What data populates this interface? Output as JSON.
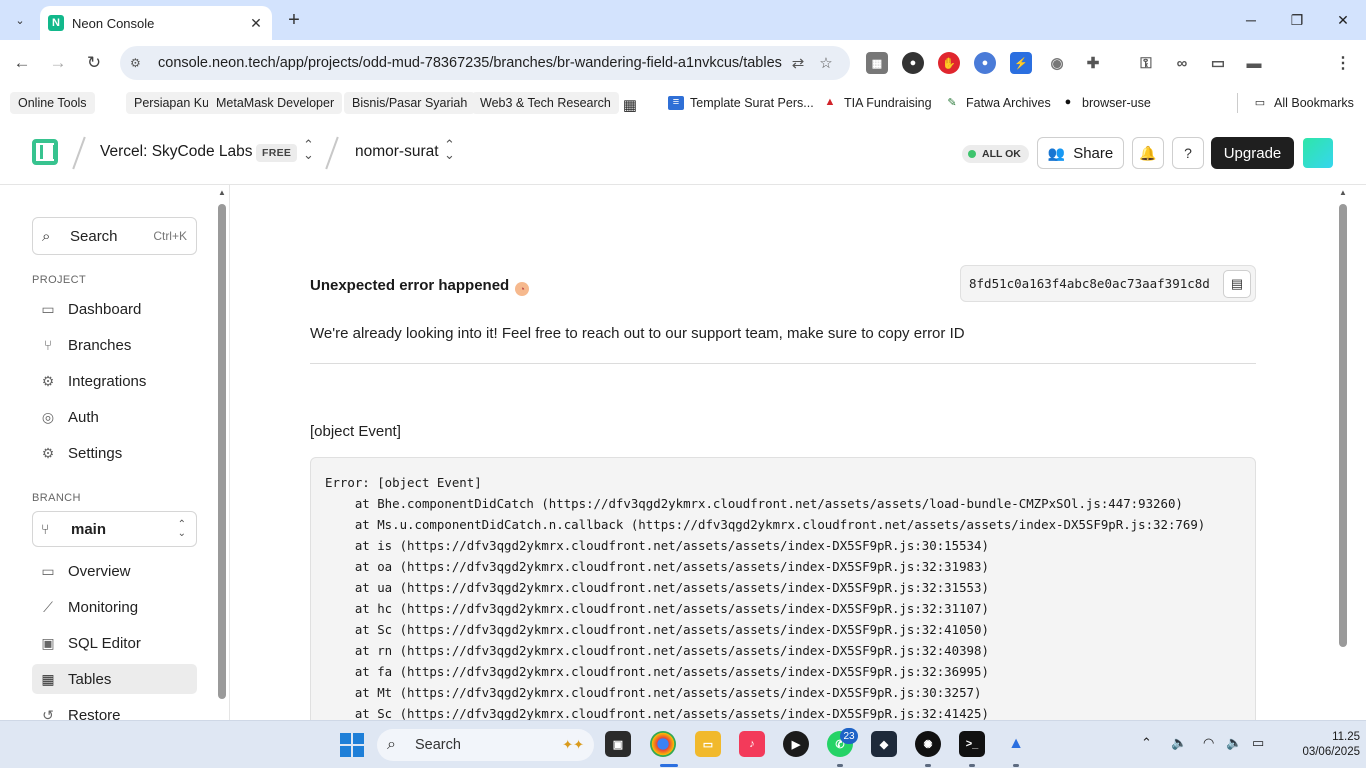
{
  "browser": {
    "tab_title": "Neon Console",
    "url": "console.neon.tech/app/projects/odd-mud-78367235/branches/br-wandering-field-a1nvkcus/tables",
    "bookmarks": [
      "Online Tools",
      "Persiapan Kuliah",
      "MetaMask Developer",
      "Bisnis/Pasar Syariah",
      "Web3 & Tech Research",
      "Template Surat Pers...",
      "TIA Fundraising",
      "Fatwa Archives",
      "browser-use"
    ],
    "all_bookmarks": "All Bookmarks"
  },
  "header": {
    "org": "Vercel: SkyCode Labs",
    "plan_badge": "FREE",
    "project": "nomor-surat",
    "status": "ALL OK",
    "share": "Share",
    "upgrade": "Upgrade",
    "accent": "#37c38f"
  },
  "sidebar": {
    "search": "Search",
    "search_shortcut": "Ctrl+K",
    "project_label": "PROJECT",
    "project_items": [
      "Dashboard",
      "Branches",
      "Integrations",
      "Auth",
      "Settings"
    ],
    "branch_label": "BRANCH",
    "branch": "main",
    "branch_items": [
      "Overview",
      "Monitoring",
      "SQL Editor",
      "Tables",
      "Restore"
    ],
    "active_item": "Tables"
  },
  "error": {
    "title": "Unexpected error happened",
    "error_id": "8fd51c0a163f4abc8e0ac73aaf391c8d",
    "description": "We're already looking into it! Feel free to reach out to our support team, make sure to copy error ID",
    "message": "[object Event]",
    "stack": [
      "Error: [object Event]",
      "    at Bhe.componentDidCatch (https://dfv3qgd2ykmrx.cloudfront.net/assets/assets/load-bundle-CMZPxSOl.js:447:93260)",
      "    at Ms.u.componentDidCatch.n.callback (https://dfv3qgd2ykmrx.cloudfront.net/assets/assets/index-DX5SF9pR.js:32:769)",
      "    at is (https://dfv3qgd2ykmrx.cloudfront.net/assets/assets/index-DX5SF9pR.js:30:15534)",
      "    at oa (https://dfv3qgd2ykmrx.cloudfront.net/assets/assets/index-DX5SF9pR.js:32:31983)",
      "    at ua (https://dfv3qgd2ykmrx.cloudfront.net/assets/assets/index-DX5SF9pR.js:32:31553)",
      "    at hc (https://dfv3qgd2ykmrx.cloudfront.net/assets/assets/index-DX5SF9pR.js:32:31107)",
      "    at Sc (https://dfv3qgd2ykmrx.cloudfront.net/assets/assets/index-DX5SF9pR.js:32:41050)",
      "    at rn (https://dfv3qgd2ykmrx.cloudfront.net/assets/assets/index-DX5SF9pR.js:32:40398)",
      "    at fa (https://dfv3qgd2ykmrx.cloudfront.net/assets/assets/index-DX5SF9pR.js:32:36995)",
      "    at Mt (https://dfv3qgd2ykmrx.cloudfront.net/assets/assets/index-DX5SF9pR.js:30:3257)",
      "    at Sc (https://dfv3qgd2ykmrx.cloudfront.net/assets/assets/index-DX5SF9pR.js:32:41425)"
    ]
  },
  "taskbar": {
    "search": "Search",
    "whatsapp_badge": "23",
    "time": "11.25",
    "date": "03/06/2025"
  }
}
